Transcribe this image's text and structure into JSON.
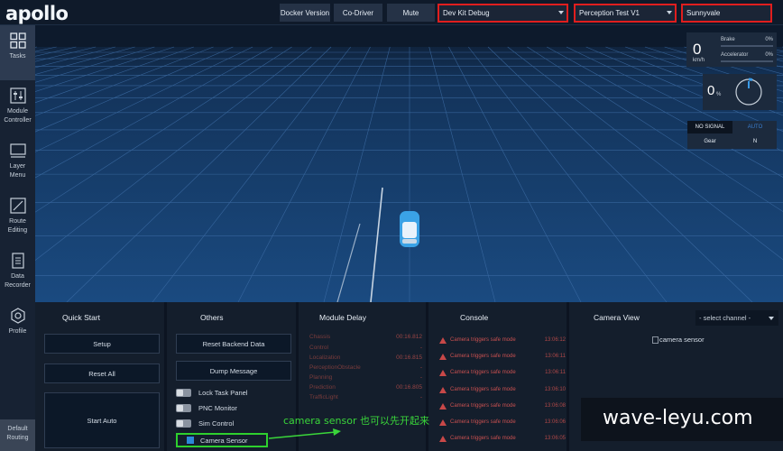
{
  "app": {
    "logo": "apollo"
  },
  "topbar": {
    "docker_version": "Docker Version",
    "co_driver": "Co-Driver",
    "mute": "Mute",
    "mode_select": "Dev Kit Debug",
    "vehicle_select": "Perception Test V1",
    "map_select": "Sunnyvale",
    "highlight_color": "#e01e1e"
  },
  "sidebar": {
    "items": [
      {
        "label_1": "Tasks",
        "label_2": "",
        "icon": "grid-icon"
      },
      {
        "label_1": "Module",
        "label_2": "Controller",
        "icon": "sliders-icon"
      },
      {
        "label_1": "Layer",
        "label_2": "Menu",
        "icon": "layer-icon"
      },
      {
        "label_1": "Route",
        "label_2": "Editing",
        "icon": "route-icon"
      },
      {
        "label_1": "Data",
        "label_2": "Recorder",
        "icon": "recorder-icon"
      },
      {
        "label_1": "Profile",
        "label_2": "",
        "icon": "profile-icon"
      }
    ],
    "default_routing_1": "Default",
    "default_routing_2": "Routing"
  },
  "dashboard": {
    "speed": "0",
    "speed_unit": "km/h",
    "brake_label": "Brake",
    "brake_value": "0%",
    "accel_label": "Accelerator",
    "accel_value": "0%",
    "steering": "0",
    "steering_unit": "%",
    "signal": "NO SIGNAL",
    "drive_mode": "AUTO",
    "gear_label": "Gear",
    "gear_value": "N"
  },
  "quick_start": {
    "title": "Quick Start",
    "setup": "Setup",
    "reset_all": "Reset All",
    "start_auto": "Start Auto"
  },
  "others": {
    "title": "Others",
    "reset_backend": "Reset Backend Data",
    "dump_message": "Dump Message",
    "toggles": [
      {
        "label": "Lock Task Panel",
        "on": false
      },
      {
        "label": "PNC Monitor",
        "on": false
      },
      {
        "label": "Sim Control",
        "on": false
      },
      {
        "label": "Camera Sensor",
        "on": true
      }
    ]
  },
  "module_delay": {
    "title": "Module Delay",
    "rows": [
      {
        "name": "Chassis",
        "value": "00:16.812"
      },
      {
        "name": "Control",
        "value": "-"
      },
      {
        "name": "Localization",
        "value": "00:16.815"
      },
      {
        "name": "PerceptionObstacle",
        "value": "-"
      },
      {
        "name": "Planning",
        "value": "-"
      },
      {
        "name": "Prediction",
        "value": "00:16.805"
      },
      {
        "name": "TrafficLight",
        "value": "-"
      }
    ]
  },
  "console": {
    "title": "Console",
    "rows": [
      {
        "text": "Camera triggers safe mode",
        "time": "13:06:12"
      },
      {
        "text": "Camera triggers safe mode",
        "time": "13:06:11"
      },
      {
        "text": "Camera triggers safe mode",
        "time": "13:06:11"
      },
      {
        "text": "Camera triggers safe mode",
        "time": "13:06:10"
      },
      {
        "text": "Camera triggers safe mode",
        "time": "13:06:08"
      },
      {
        "text": "Camera triggers safe mode",
        "time": "13:06:06"
      },
      {
        "text": "Camera triggers safe mode",
        "time": "13:06:05"
      }
    ]
  },
  "camera_view": {
    "title": "Camera View",
    "channel_placeholder": "- select channel -",
    "image_alt": "camera sensor"
  },
  "annotation": {
    "text": "camera sensor 也可以先开起来",
    "color": "#3ad63a"
  },
  "watermark": {
    "text": "wave-leyu.com"
  }
}
